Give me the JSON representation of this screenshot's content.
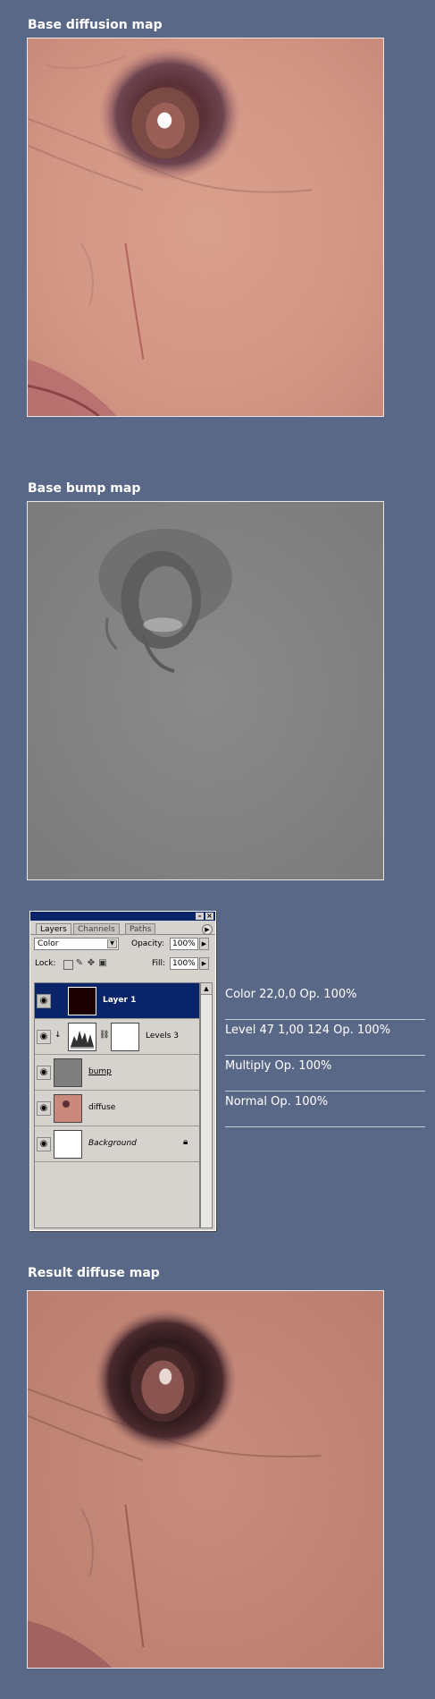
{
  "sections": {
    "base_diffusion": {
      "title": "Base diffusion map"
    },
    "base_bump": {
      "title": "Base bump map"
    },
    "result_diffuse": {
      "title": "Result diffuse map"
    }
  },
  "layers_panel": {
    "tabs": [
      "Layers",
      "Channels",
      "Paths"
    ],
    "blend_mode": "Color",
    "opacity_label": "Opacity:",
    "opacity_value": "100%",
    "lock_label": "Lock:",
    "fill_label": "Fill:",
    "fill_value": "100%",
    "layers": [
      {
        "name": "Layer 1",
        "selected": true
      },
      {
        "name": "Levels 3",
        "selected": false
      },
      {
        "name": "bump",
        "selected": false
      },
      {
        "name": "diffuse",
        "selected": false
      },
      {
        "name": "Background",
        "selected": false
      }
    ]
  },
  "legend": [
    "Color 22,0,0 Op. 100%",
    "Level 47 1,00 124 Op. 100%",
    "Multiply Op. 100%",
    "Normal Op. 100%"
  ],
  "icons": {
    "eye": "eye-icon",
    "lock": "lock-icon",
    "link": "chain-link-icon",
    "dropdown": "chevron-down-icon",
    "menu": "panel-menu-icon"
  },
  "colors": {
    "background": "#5a6887",
    "selection": "#0a246a",
    "panel": "#d6d3ce"
  }
}
